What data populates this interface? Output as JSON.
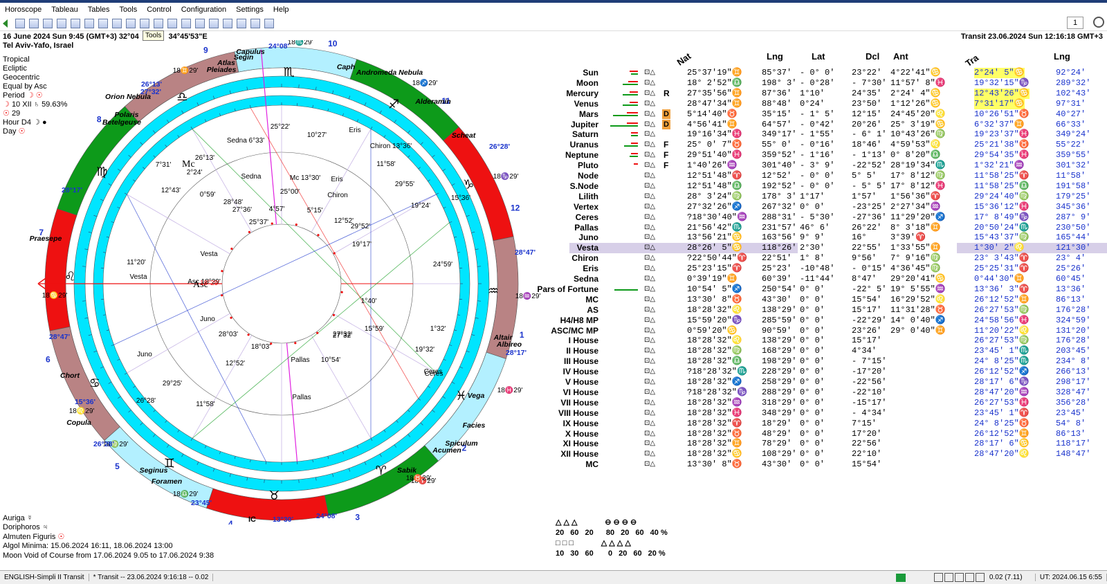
{
  "menu": [
    "Horoscope",
    "Tableau",
    "Tables",
    "Tools",
    "Control",
    "Configuration",
    "Settings",
    "Help"
  ],
  "toolbar": {
    "tooltip": "Tools",
    "spin_value": "1"
  },
  "chart_info": {
    "date_line": "16 June 2024   Sun   9:45 (GMT+3) 32°04",
    "lon": "34°45'53\"E",
    "place": "Tel Aviv-Yafo, Israel",
    "modes": [
      "Tropical",
      "Ecliptic",
      "Geocentric",
      "Equal by Asc"
    ],
    "period_label": "Period",
    "moon_line": "10 XII",
    "moon_pct": "59.63%",
    "num29": "29",
    "hour_label": "Hour D4",
    "day_label": "Day"
  },
  "transit_header": "Transit 23.06.2024   Sun 12:16:18 GMT+3",
  "wheel": {
    "house_numbers": [
      "1",
      "2",
      "3",
      "4",
      "5",
      "6",
      "7",
      "8",
      "9",
      "10",
      "11",
      "12"
    ],
    "asc_label": "Asc",
    "asc_deg": "18°29'",
    "mc_label": "Mc",
    "mc_deg": "13°30'",
    "ic_label": "IC",
    "ic_deg": "13°30'",
    "cusp_labels": [
      "18♋29'",
      "18♌29'",
      "18♍29'",
      "18♎29'",
      "18♏29'",
      "18♐29'",
      "18♑29'",
      "18♒29'",
      "18♓29'",
      "18♈29'",
      "18♉29'",
      "18♊29'"
    ],
    "stars": [
      "Capulus",
      "Segin",
      "Atlas",
      "Pleiades",
      "Caph",
      "Andromeda Nebula",
      "Alderamin",
      "Orion Nebula",
      "Polaris",
      "Betelgeuse",
      "Scheat",
      "Praesepe",
      "Altair",
      "Albireo",
      "Vega",
      "Facies",
      "Spiculum",
      "Acumen",
      "Sabik",
      "Copula",
      "Seginus",
      "Foramen",
      "Chort"
    ],
    "outer_degs": [
      "24°08'",
      "26°13'",
      "27°32'",
      "26°28'",
      "28°17'",
      "28°47'",
      "28°47'",
      "28°17'",
      "15°36'",
      "26°28'",
      "23°45'",
      "24°08'",
      "13°30'"
    ],
    "transit_planets": [
      "Sedna 6°33'",
      "25°22'",
      "10°27'",
      "Eris",
      "Chiron 13°36'",
      "11°58'",
      "29°55'",
      "19°24'",
      "15°36'",
      "26°13'",
      "7°31'",
      "12°43'",
      "2°24'",
      "18°03'",
      "28°03'",
      "12°52'",
      "11°58'",
      "29°25'",
      "26°28'",
      "27°32'",
      "19°32'",
      "10°54'",
      "Pallas",
      "Ceres",
      "Juno",
      "Vesta"
    ],
    "natal_planets": [
      "Sedna",
      "25°00'",
      "Mc 13°30'",
      "Eris",
      "Chiron",
      "0°59'",
      "28°48'",
      "27°36'",
      "4°57'",
      "5°15'",
      "12°52'",
      "29°52'",
      "19°17'",
      "25°37'",
      "1°40'",
      "1°32'",
      "15°59'",
      "27°32'",
      "Vesta",
      "Asc 18°29'",
      "Juno",
      "Pallas",
      "Ceres",
      "24°59'",
      "11°20'"
    ]
  },
  "table": {
    "headers": {
      "nat": "Nat",
      "lng": "Lng",
      "lat": "Lat",
      "dcl": "Dcl",
      "ant": "Ant",
      "tra": "Tra",
      "lng2": "Lng"
    },
    "rows": [
      {
        "name": "Sun",
        "flags": "",
        "nat": "25°37'19\"♊",
        "lng": "85°37'",
        "lat": "- 0° 0'",
        "dcl": "23°22'",
        "ant": "4°22'41\"♋",
        "tra": "2°24' 5\"♋",
        "tlng": "92°24'",
        "hl": true
      },
      {
        "name": "Moon",
        "flags": "",
        "nat": "18° 2'52\"♎",
        "lng": "198° 3'",
        "lat": "- 0°28'",
        "dcl": "- 7°30'",
        "ant": "11°57' 8\"♓",
        "tra": "19°32'15\"♑",
        "tlng": "289°32'"
      },
      {
        "name": "Mercury",
        "flags": "R",
        "nat": "27°35'56\"♊",
        "lng": "87°36'",
        "lat": "1°10'",
        "dcl": "24°35'",
        "ant": "2°24' 4\"♋",
        "tra": "12°43'26\"♋",
        "tlng": "102°43'",
        "hl": true
      },
      {
        "name": "Venus",
        "flags": "",
        "nat": "28°47'34\"♊",
        "lng": "88°48'",
        "lat": "0°24'",
        "dcl": "23°50'",
        "ant": "1°12'26\"♋",
        "tra": "7°31'17\"♋",
        "tlng": "97°31'",
        "hl": true
      },
      {
        "name": "Mars",
        "flags": "D",
        "nat": "5°14'40\"♉",
        "lng": "35°15'",
        "lat": "- 1° 5'",
        "dcl": "12°15'",
        "ant": "24°45'20\"♌",
        "tra": "10°26'51\"♉",
        "tlng": "40°27'"
      },
      {
        "name": "Jupiter",
        "flags": "D",
        "nat": "4°56'41\"♊",
        "lng": "64°57'",
        "lat": "- 0°42'",
        "dcl": "20°26'",
        "ant": "25° 3'19\"♋",
        "tra": "6°32'37\"♊",
        "tlng": "66°33'"
      },
      {
        "name": "Saturn",
        "flags": "",
        "nat": "19°16'34\"♓",
        "lng": "349°17'",
        "lat": "- 1°55'",
        "dcl": "- 6° 1'",
        "ant": "10°43'26\"♍",
        "tra": "19°23'37\"♓",
        "tlng": "349°24'"
      },
      {
        "name": "Uranus",
        "flags": "F",
        "nat": "25° 0' 7\"♉",
        "lng": "55° 0'",
        "lat": "- 0°16'",
        "dcl": "18°46'",
        "ant": "4°59'53\"♌",
        "tra": "25°21'38\"♉",
        "tlng": "55°22'"
      },
      {
        "name": "Neptune",
        "flags": "F",
        "nat": "29°51'40\"♓",
        "lng": "359°52'",
        "lat": "- 1°16'",
        "dcl": "- 1°13'",
        "ant": "0° 8'20\"♎",
        "tra": "29°54'35\"♓",
        "tlng": "359°55'"
      },
      {
        "name": "Pluto",
        "flags": "F",
        "nat": "1°40'26\"♒",
        "lng": "301°40'",
        "lat": "- 3° 9'",
        "dcl": "-22°52'",
        "ant": "28°19'34\"♏",
        "tra": "1°32'21\"♒",
        "tlng": "301°32'"
      },
      {
        "name": "Node",
        "flags": "",
        "nat": "12°51'48\"♈",
        "lng": "12°52'",
        "lat": "- 0° 0'",
        "dcl": "5° 5'",
        "ant": "17° 8'12\"♍",
        "tra": "11°58'25\"♈",
        "tlng": "11°58'"
      },
      {
        "name": "S.Node",
        "flags": "",
        "nat": "12°51'48\"♎",
        "lng": "192°52'",
        "lat": "- 0° 0'",
        "dcl": "- 5° 5'",
        "ant": "17° 8'12\"♓",
        "tra": "11°58'25\"♎",
        "tlng": "191°58'"
      },
      {
        "name": "Lilith",
        "flags": "",
        "nat": "28° 3'24\"♍",
        "lng": "178° 3'",
        "lat": "1°17'",
        "dcl": "1°57'",
        "ant": "1°56'36\"♈",
        "tra": "29°24'40\"♍",
        "tlng": "179°25'"
      },
      {
        "name": "Vertex",
        "flags": "",
        "nat": "27°32'26\"♐",
        "lng": "267°32'",
        "lat": "0° 0'",
        "dcl": "-23°25'",
        "ant": "2°27'34\"♒",
        "tra": "15°36'12\"♓",
        "tlng": "345°36'"
      },
      {
        "name": "Ceres",
        "flags": "",
        "nat": "?18°30'40\"♒",
        "lng": "288°31'",
        "lat": "- 5°30'",
        "dcl": "-27°36'",
        "ant": "11°29'20\"♐",
        "tra": "17° 8'49\"♑",
        "tlng": "287° 9'"
      },
      {
        "name": "Pallas",
        "flags": "",
        "nat": "21°56'42\"♏",
        "lng": "231°57'",
        "lat": "46° 6'",
        "dcl": "26°22'",
        "ant": "8° 3'18\"♊",
        "tra": "20°50'24\"♏",
        "tlng": "230°50'"
      },
      {
        "name": "Juno",
        "flags": "",
        "nat": "13°56'21\"♋",
        "lng": "163°56'",
        "lat": "9° 9'",
        "dcl": "16°",
        "ant": "3°39'♈",
        "tra": "15°43'37\"♍",
        "tlng": "165°44'"
      },
      {
        "name": "Vesta",
        "flags": "",
        "nat": "28°26' 5\"♋",
        "lng": "118°26'",
        "lat": "2°30'",
        "dcl": "22°55'",
        "ant": "1°33'55\"♊",
        "tra": "1°30' 2\"♌",
        "tlng": "121°30'",
        "sel": true
      },
      {
        "name": "Chiron",
        "flags": "",
        "nat": "?22°50'44\"♈",
        "lng": "22°51'",
        "lat": "1° 8'",
        "dcl": "9°56'",
        "ant": "7° 9'16\"♍",
        "tra": "23° 3'43\"♈",
        "tlng": "23° 4'"
      },
      {
        "name": "Eris",
        "flags": "",
        "nat": "25°23'15\"♈",
        "lng": "25°23'",
        "lat": "-10°48'",
        "dcl": "- 0°15'",
        "ant": "4°36'45\"♍",
        "tra": "25°25'31\"♈",
        "tlng": "25°26'"
      },
      {
        "name": "Sedna",
        "flags": "",
        "nat": "0°39'19\"♊",
        "lng": "60°39'",
        "lat": "-11°44'",
        "dcl": "8°47'",
        "ant": "29°20'41\"♋",
        "tra": "0°44'30\"♊",
        "tlng": "60°45'"
      },
      {
        "name": "Pars of Fortune",
        "flags": "",
        "nat": "10°54' 5\"♐",
        "lng": "250°54'",
        "lat": "0° 0'",
        "dcl": "-22° 5'",
        "ant": "19° 5'55\"♒",
        "tra": "13°36' 3\"♈",
        "tlng": "13°36'"
      },
      {
        "name": "MC",
        "flags": "",
        "nat": "13°30' 8\"♉",
        "lng": "43°30'",
        "lat": "0° 0'",
        "dcl": "15°54'",
        "ant": "16°29'52\"♌",
        "tra": "26°12'52\"♊",
        "tlng": "86°13'"
      },
      {
        "name": "AS",
        "flags": "",
        "nat": "18°28'32\"♌",
        "lng": "138°29'",
        "lat": "0° 0'",
        "dcl": "15°17'",
        "ant": "11°31'28\"♉",
        "tra": "26°27'53\"♍",
        "tlng": "176°28'"
      },
      {
        "name": "H4/H8 MP",
        "flags": "",
        "nat": "15°59'20\"♑",
        "lng": "285°59'",
        "lat": "0° 0'",
        "dcl": "-22°29'",
        "ant": "14° 0'40\"♐",
        "tra": "24°58'56\"♓",
        "tlng": "324°59'"
      },
      {
        "name": "ASC/MC MP",
        "flags": "",
        "nat": "0°59'20\"♋",
        "lng": "90°59'",
        "lat": "0° 0'",
        "dcl": "23°26'",
        "ant": "29° 0'40\"♊",
        "tra": "11°20'22\"♌",
        "tlng": "131°20'"
      },
      {
        "name": "I House",
        "flags": "",
        "nat": "18°28'32\"♌",
        "lng": "138°29'",
        "lat": "0° 0'",
        "dcl": "15°17'",
        "ant": "",
        "tra": "26°27'53\"♍",
        "tlng": "176°28'"
      },
      {
        "name": "II House",
        "flags": "",
        "nat": "18°28'32\"♍",
        "lng": "168°29'",
        "lat": "0° 0'",
        "dcl": "4°34'",
        "ant": "",
        "tra": "23°45' 1\"♏",
        "tlng": "203°45'"
      },
      {
        "name": "III House",
        "flags": "",
        "nat": "18°28'32\"♎",
        "lng": "198°29'",
        "lat": "0° 0'",
        "dcl": "- 7°15'",
        "ant": "",
        "tra": "24° 8'25\"♏",
        "tlng": "234° 8'"
      },
      {
        "name": "IV House",
        "flags": "",
        "nat": "?18°28'32\"♏",
        "lng": "228°29'",
        "lat": "0° 0'",
        "dcl": "-17°20'",
        "ant": "",
        "tra": "26°12'52\"♐",
        "tlng": "266°13'"
      },
      {
        "name": "V House",
        "flags": "",
        "nat": "18°28'32\"♐",
        "lng": "258°29'",
        "lat": "0° 0'",
        "dcl": "-22°56'",
        "ant": "",
        "tra": "28°17' 6\"♑",
        "tlng": "298°17'"
      },
      {
        "name": "VI House",
        "flags": "",
        "nat": "?18°28'32\"♑",
        "lng": "288°29'",
        "lat": "0° 0'",
        "dcl": "-22°10'",
        "ant": "",
        "tra": "28°47'20\"♒",
        "tlng": "328°47'"
      },
      {
        "name": "VII House",
        "flags": "",
        "nat": "18°28'32\"♒",
        "lng": "318°29'",
        "lat": "0° 0'",
        "dcl": "-15°17'",
        "ant": "",
        "tra": "26°27'53\"♓",
        "tlng": "356°28'"
      },
      {
        "name": "VIII House",
        "flags": "",
        "nat": "18°28'32\"♓",
        "lng": "348°29'",
        "lat": "0° 0'",
        "dcl": "- 4°34'",
        "ant": "",
        "tra": "23°45' 1\"♈",
        "tlng": "23°45'"
      },
      {
        "name": "IX House",
        "flags": "",
        "nat": "18°28'32\"♈",
        "lng": "18°29'",
        "lat": "0° 0'",
        "dcl": "7°15'",
        "ant": "",
        "tra": "24° 8'25\"♉",
        "tlng": "54° 8'"
      },
      {
        "name": "X House",
        "flags": "",
        "nat": "18°28'32\"♉",
        "lng": "48°29'",
        "lat": "0° 0'",
        "dcl": "17°20'",
        "ant": "",
        "tra": "26°12'52\"♊",
        "tlng": "86°13'"
      },
      {
        "name": "XI House",
        "flags": "",
        "nat": "18°28'32\"♊",
        "lng": "78°29'",
        "lat": "0° 0'",
        "dcl": "22°56'",
        "ant": "",
        "tra": "28°17' 6\"♋",
        "tlng": "118°17'"
      },
      {
        "name": "XII House",
        "flags": "",
        "nat": "18°28'32\"♋",
        "lng": "108°29'",
        "lat": "0° 0'",
        "dcl": "22°10'",
        "ant": "",
        "tra": "28°47'20\"♌",
        "tlng": "148°47'"
      },
      {
        "name": "MC",
        "flags": "",
        "nat": "13°30' 8\"♉",
        "lng": "43°30'",
        "lat": "0° 0'",
        "dcl": "15°54'",
        "ant": "",
        "tra": "",
        "tlng": ""
      }
    ]
  },
  "stats": {
    "row1": [
      "20",
      "60",
      "20"
    ],
    "row1b": [
      "80",
      "20",
      "60",
      "40 %"
    ],
    "row2": [
      "10",
      "30",
      "60"
    ],
    "row2b": [
      "0",
      "20",
      "60",
      "20 %"
    ]
  },
  "bottom": {
    "auriga": "Auriga",
    "doriphoros": "Doriphoros",
    "almuten": "Almuten Figuris",
    "algol": "Algol Minima: 15.06.2024 16:11,   18.06.2024 13:00",
    "void": "Moon Void of Course from 17.06.2024  9.05 to 17.06.2024  9:38"
  },
  "status": {
    "lang": "ENGLISH-Simpli II Transit",
    "transit": "*  Transit -- 23.06.2024  9:16:18 -- 0.02",
    "val": "0.02 (7.11)",
    "ut": "UT: 2024.06.15 6:55"
  },
  "colors": {
    "red": "#ee1111",
    "green": "#0d9a1a",
    "cyan": "#00e5ff",
    "lightcyan": "#b3f0ff",
    "brown": "#b98384",
    "blue": "#1a33cc",
    "yellow": "#ffff66"
  }
}
